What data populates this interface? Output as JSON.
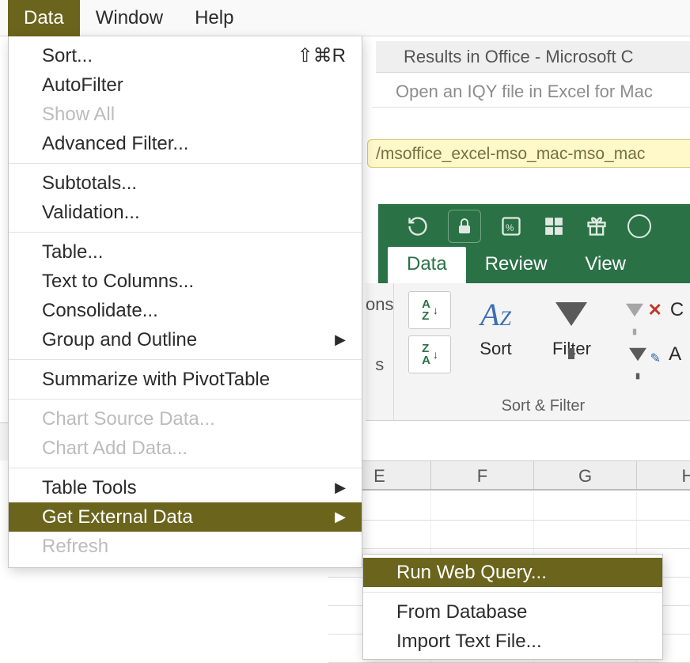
{
  "menuBar": {
    "data": "Data",
    "window": "Window",
    "help": "Help"
  },
  "dataMenu": {
    "sort": "Sort...",
    "sortShortcut": "⇧⌘R",
    "autoFilter": "AutoFilter",
    "showAll": "Show All",
    "advancedFilter": "Advanced Filter...",
    "subtotals": "Subtotals...",
    "validation": "Validation...",
    "table": "Table...",
    "textToColumns": "Text to Columns...",
    "consolidate": "Consolidate...",
    "groupOutline": "Group and Outline",
    "pivot": "Summarize with PivotTable",
    "chartSource": "Chart Source Data...",
    "chartAdd": "Chart Add Data...",
    "tableTools": "Table Tools",
    "getExternal": "Get External Data",
    "refresh": "Refresh"
  },
  "externalSub": {
    "runWebQuery": "Run Web Query...",
    "fromDatabase": "From Database",
    "importText": "Import Text File..."
  },
  "window": {
    "title": "Results in Office - Microsoft C",
    "subtitle": "Open an IQY file in Excel for Mac ",
    "url": "/msoffice_excel-mso_mac-mso_mac"
  },
  "ribbonPartial": {
    "ons": "ons",
    "s": "s"
  },
  "tabs": {
    "data": "Data",
    "review": "Review",
    "view": "View"
  },
  "miniSort": {
    "az": "A\nZ",
    "za": "Z\nA"
  },
  "ribbon": {
    "sort": "Sort",
    "filter": "Filter",
    "clear": "C",
    "advanced": "A",
    "group": "Sort & Filter"
  },
  "columns": [
    "E",
    "F",
    "G",
    "H"
  ]
}
